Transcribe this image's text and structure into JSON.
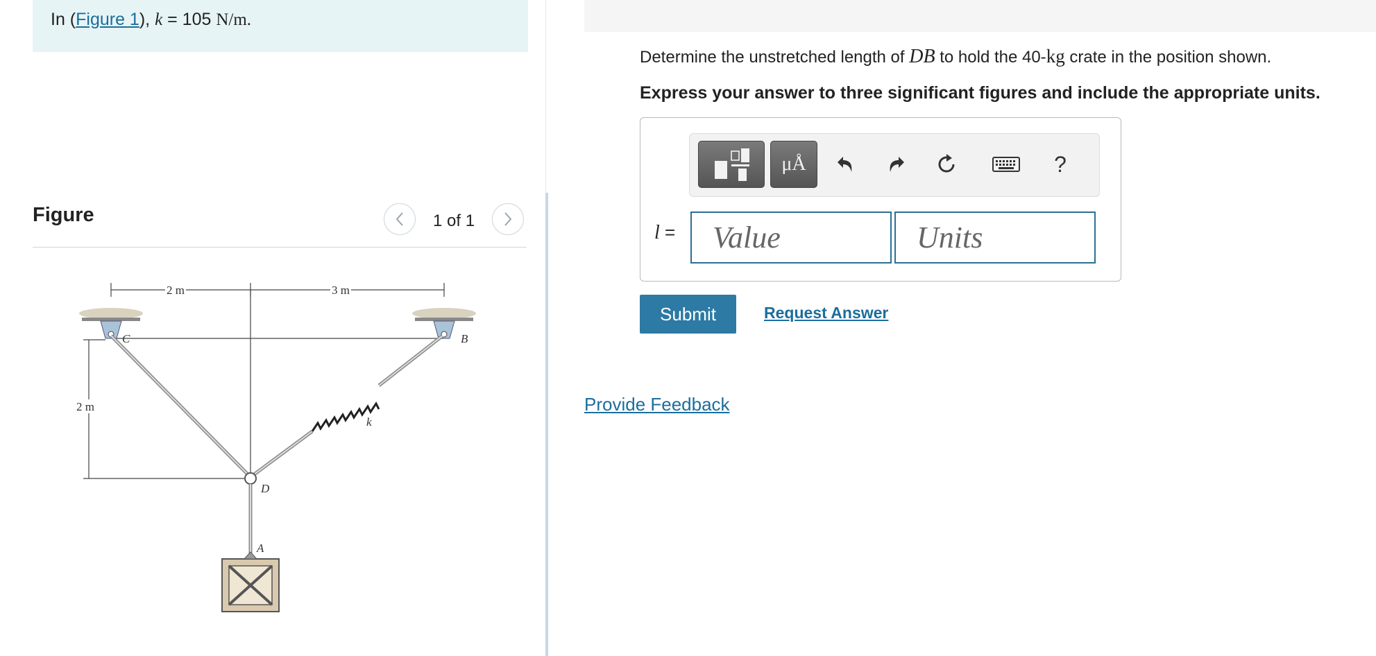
{
  "intro": {
    "prefix": "In (",
    "figure_link": "Figure 1",
    "suffix": "), ",
    "var": "k",
    "eq": " = 105 ",
    "unit": "N/m."
  },
  "figure_panel": {
    "title": "Figure",
    "page_counter": "1 of 1",
    "prev_icon": "chevron-left-icon",
    "next_icon": "chevron-right-icon"
  },
  "diagram": {
    "dim_top_left": "2 m",
    "dim_top_right": "3 m",
    "dim_left": "2 m",
    "label_C": "C",
    "label_B": "B",
    "label_D": "D",
    "label_A": "A",
    "label_k": "k"
  },
  "question": {
    "line1_a": "Determine the unstretched length of ",
    "line1_var": "DB",
    "line1_b": " to hold the 40-",
    "line1_unit": "kg",
    "line1_c": " crate in the position shown.",
    "instruction": "Express your answer to three significant figures and include the appropriate units."
  },
  "toolbar": {
    "units_button_label": "μÅ",
    "help_label": "?",
    "icons": [
      "fraction-template-icon",
      "units-icon",
      "undo-icon",
      "redo-icon",
      "reset-icon",
      "keyboard-icon",
      "help-icon"
    ]
  },
  "answer": {
    "label": "l",
    "equals": " =",
    "value_placeholder": "Value",
    "units_placeholder": "Units"
  },
  "actions": {
    "submit": "Submit",
    "request_answer": "Request Answer",
    "feedback": "Provide Feedback"
  },
  "colors": {
    "accent": "#2d7aa4",
    "link": "#1b6e9c",
    "intro_bg": "#e7f4f6"
  }
}
